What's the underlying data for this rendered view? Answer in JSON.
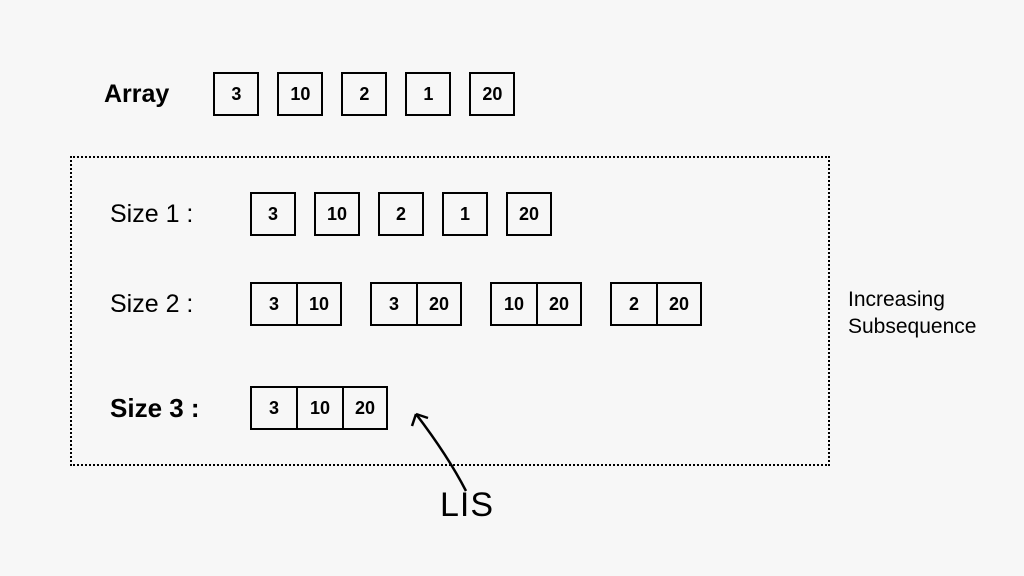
{
  "array_label": "Array",
  "array_values": [
    "3",
    "10",
    "2",
    "1",
    "20"
  ],
  "size1_label": "Size 1 :",
  "size1_values": [
    "3",
    "10",
    "2",
    "1",
    "20"
  ],
  "size2_label": "Size 2 :",
  "size2_pairs": [
    [
      "3",
      "10"
    ],
    [
      "3",
      "20"
    ],
    [
      "10",
      "20"
    ],
    [
      "2",
      "20"
    ]
  ],
  "size3_label": "Size 3 :",
  "size3_triple": [
    "3",
    "10",
    "20"
  ],
  "side_label_line1": "Increasing",
  "side_label_line2": "Subsequence",
  "lis_label": "LIS"
}
